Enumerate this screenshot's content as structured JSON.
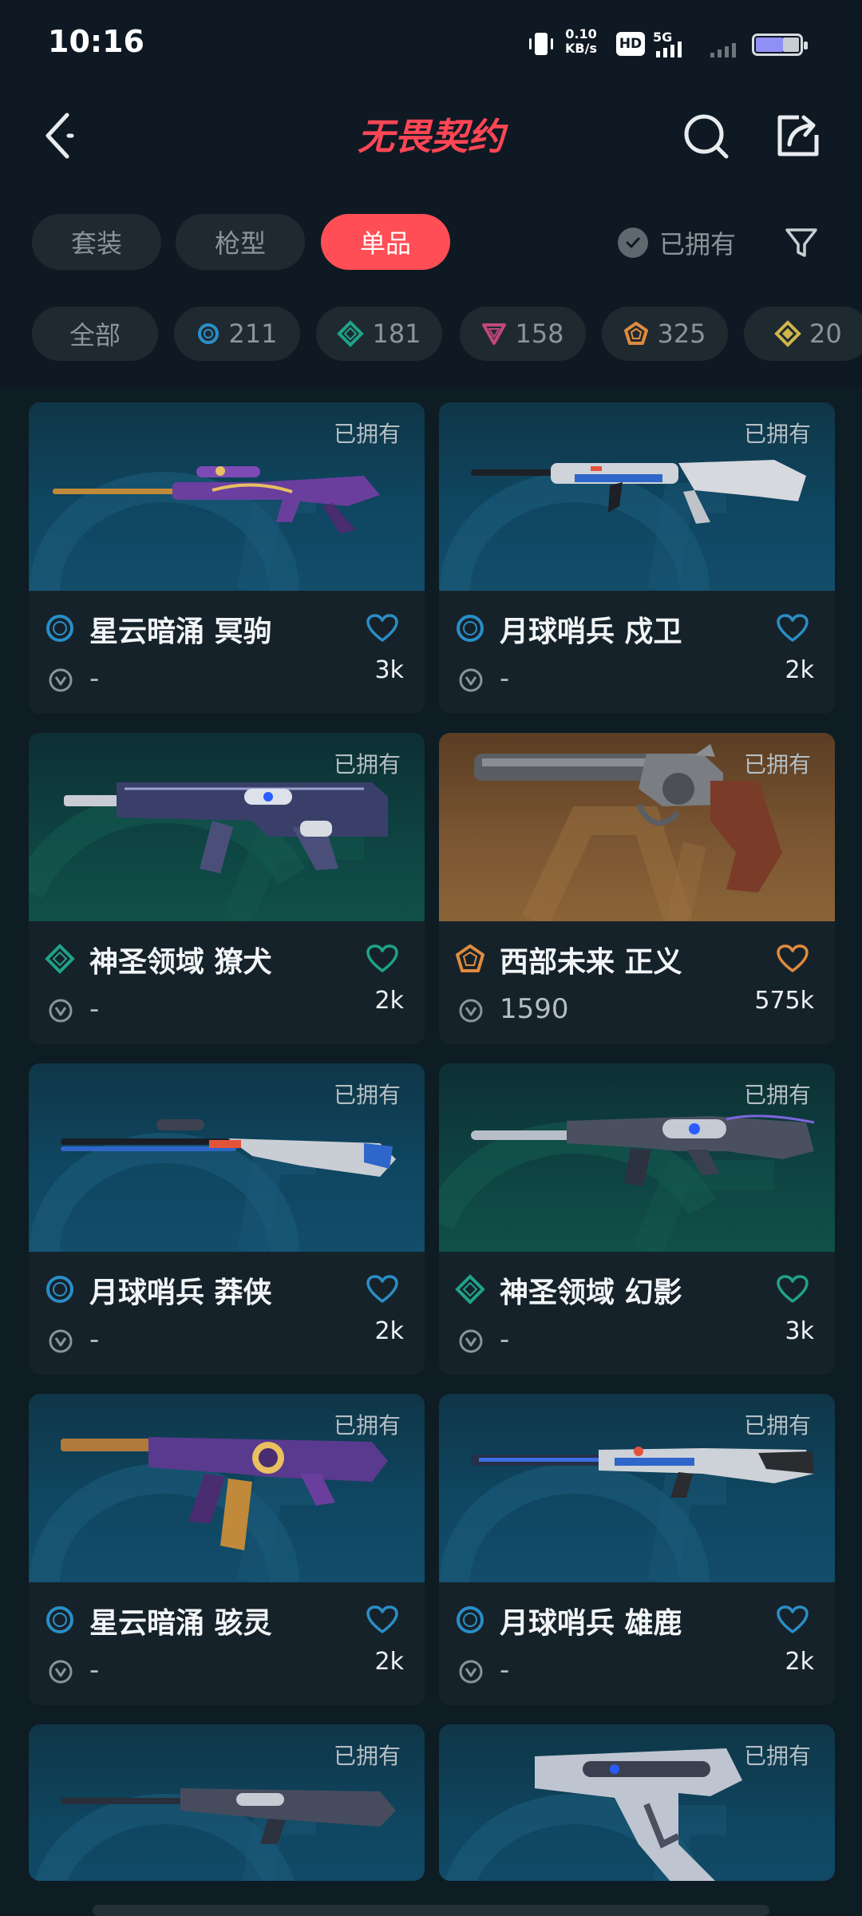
{
  "status_bar": {
    "time": "10:16",
    "net_speed_value": "0.10",
    "net_speed_unit": "KB/s",
    "hd_label": "HD",
    "signal_label": "5G"
  },
  "header": {
    "title": "无畏契约",
    "icons": [
      "back-arrow-icon",
      "search-icon",
      "share-icon"
    ]
  },
  "tabs": [
    {
      "label": "套装",
      "active": false
    },
    {
      "label": "枪型",
      "active": false
    },
    {
      "label": "单品",
      "active": true
    }
  ],
  "owned_filter": {
    "label": "已拥有"
  },
  "chips": [
    {
      "label": "全部",
      "tier": "none"
    },
    {
      "label": "211",
      "tier": "select",
      "color": "#2a8ec6"
    },
    {
      "label": "181",
      "tier": "deluxe",
      "color": "#1fa38a"
    },
    {
      "label": "158",
      "tier": "premium",
      "color": "#c2467f"
    },
    {
      "label": "325",
      "tier": "exclusive",
      "color": "#e08b3e"
    },
    {
      "label": "20",
      "tier": "ultra",
      "color": "#d2b54a"
    }
  ],
  "items": [
    {
      "name": "星云暗涌 冥驹",
      "owned_label": "已拥有",
      "price": "-",
      "likes": "3k",
      "tier": "select",
      "tier_color": "#2a8ec6",
      "heart_color": "#2a8ec6",
      "bg": "blue",
      "weapon": "sniper"
    },
    {
      "name": "月球哨兵 戍卫",
      "owned_label": "已拥有",
      "price": "-",
      "likes": "2k",
      "tier": "select",
      "tier_color": "#2a8ec6",
      "heart_color": "#2a8ec6",
      "bg": "blue",
      "weapon": "guardian"
    },
    {
      "name": "神圣领域 獠犬",
      "owned_label": "已拥有",
      "price": "-",
      "likes": "2k",
      "tier": "deluxe",
      "tier_color": "#1fa38a",
      "heart_color": "#1fa38a",
      "bg": "green",
      "weapon": "bulldog"
    },
    {
      "name": "西部未来 正义",
      "owned_label": "已拥有",
      "price": "1590",
      "likes": "575k",
      "tier": "exclusive",
      "tier_color": "#e08b3e",
      "heart_color": "#e08b3e",
      "bg": "gold",
      "weapon": "revolver"
    },
    {
      "name": "月球哨兵 莽侠",
      "owned_label": "已拥有",
      "price": "-",
      "likes": "2k",
      "tier": "select",
      "tier_color": "#2a8ec6",
      "heart_color": "#2a8ec6",
      "bg": "blue",
      "weapon": "marshal"
    },
    {
      "name": "神圣领域 幻影",
      "owned_label": "已拥有",
      "price": "-",
      "likes": "3k",
      "tier": "deluxe",
      "tier_color": "#1fa38a",
      "heart_color": "#1fa38a",
      "bg": "green",
      "weapon": "phantom"
    },
    {
      "name": "星云暗涌 骇灵",
      "owned_label": "已拥有",
      "price": "-",
      "likes": "2k",
      "tier": "select",
      "tier_color": "#2a8ec6",
      "heart_color": "#2a8ec6",
      "bg": "blue",
      "weapon": "spectre"
    },
    {
      "name": "月球哨兵 雄鹿",
      "owned_label": "已拥有",
      "price": "-",
      "likes": "2k",
      "tier": "select",
      "tier_color": "#2a8ec6",
      "heart_color": "#2a8ec6",
      "bg": "blue",
      "weapon": "bucky"
    },
    {
      "name": "",
      "owned_label": "已拥有",
      "price": "",
      "likes": "",
      "tier": "select",
      "tier_color": "#2a8ec6",
      "heart_color": "#2a8ec6",
      "bg": "blue",
      "weapon": "rifle"
    },
    {
      "name": "",
      "owned_label": "已拥有",
      "price": "",
      "likes": "",
      "tier": "select",
      "tier_color": "#2a8ec6",
      "heart_color": "#2a8ec6",
      "bg": "blue",
      "weapon": "pistol"
    }
  ]
}
